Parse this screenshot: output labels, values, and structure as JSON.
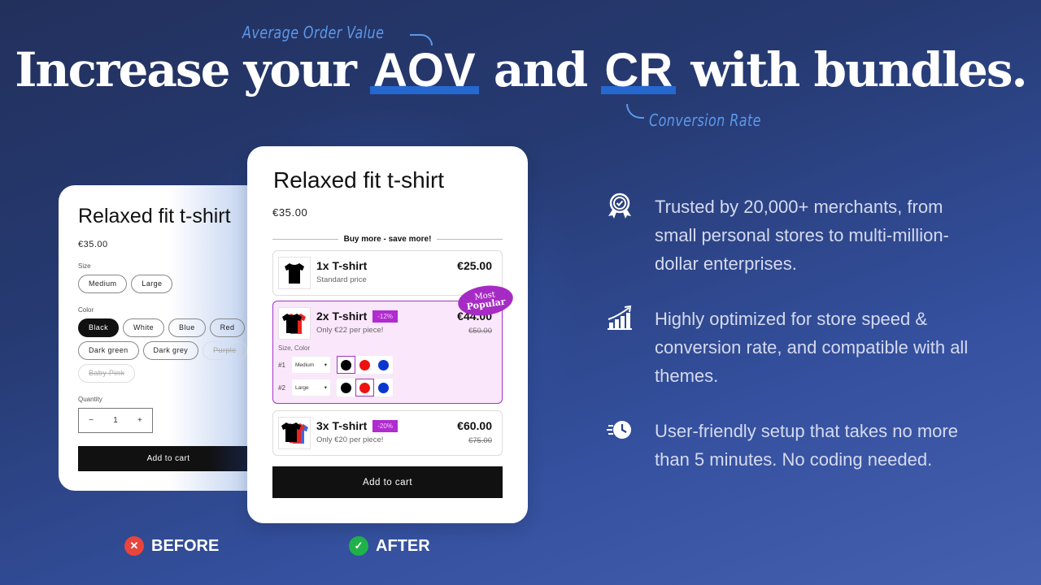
{
  "headline": {
    "part1": "Increase your",
    "highlight1": "AOV",
    "part2": "and",
    "highlight2": "CR",
    "part3": "with bundles.",
    "highlight_color": "#2568cf",
    "note_aov": "Average Order Value",
    "note_cr": "Conversion Rate",
    "note_color": "#5c98ea"
  },
  "before_card": {
    "title": "Relaxed fit t-shirt",
    "price": "€35.00",
    "size_label": "Size",
    "sizes": [
      "Medium",
      "Large"
    ],
    "color_label": "Color",
    "colors": [
      {
        "label": "Black",
        "state": "active"
      },
      {
        "label": "White",
        "state": "normal"
      },
      {
        "label": "Blue",
        "state": "normal"
      },
      {
        "label": "Red",
        "state": "normal"
      },
      {
        "label": "Dark green",
        "state": "normal"
      },
      {
        "label": "Dark grey",
        "state": "normal"
      },
      {
        "label": "Purple",
        "state": "disabled"
      },
      {
        "label": "Baby Pink",
        "state": "disabled"
      }
    ],
    "quantity_label": "Quantity",
    "quantity": "1",
    "minus": "−",
    "plus": "+",
    "add_to_cart": "Add to cart"
  },
  "after_card": {
    "title": "Relaxed fit t-shirt",
    "price": "€35.00",
    "divider_text": "Buy more - save more!",
    "offers": [
      {
        "name": "1x T-shirt",
        "subtitle": "Standard price",
        "price": "€25.00"
      },
      {
        "name": "2x T-shirt",
        "discount": "-12%",
        "subtitle": "Only €22 per piece!",
        "price": "€44.00",
        "compare_price": "€50.00",
        "badge_line1": "Most",
        "badge_line2": "Popular",
        "variants_label": "Size, Color",
        "variants": [
          {
            "num": "#1",
            "size": "Medium",
            "selected_color": 0
          },
          {
            "num": "#2",
            "size": "Large",
            "selected_color": 1
          }
        ]
      },
      {
        "name": "3x T-shirt",
        "discount": "-20%",
        "subtitle": "Only €20 per piece!",
        "price": "€60.00",
        "compare_price": "€75.00"
      }
    ],
    "swatch_colors": [
      "#000000",
      "#ee1111",
      "#0a36d0"
    ],
    "add_to_cart": "Add to cart",
    "accent_color": "#a533c4"
  },
  "labels": {
    "before": "BEFORE",
    "after": "AFTER"
  },
  "features": [
    {
      "icon": "award-badge-icon",
      "text": "Trusted by 20,000+ merchants, from small personal stores to multi-million-dollar enterprises."
    },
    {
      "icon": "growth-chart-icon",
      "text": "Highly optimized for store speed & conversion rate, and compatible with all themes."
    },
    {
      "icon": "fast-clock-icon",
      "text": "User-friendly setup that takes no more than 5 minutes. No coding needed."
    }
  ]
}
